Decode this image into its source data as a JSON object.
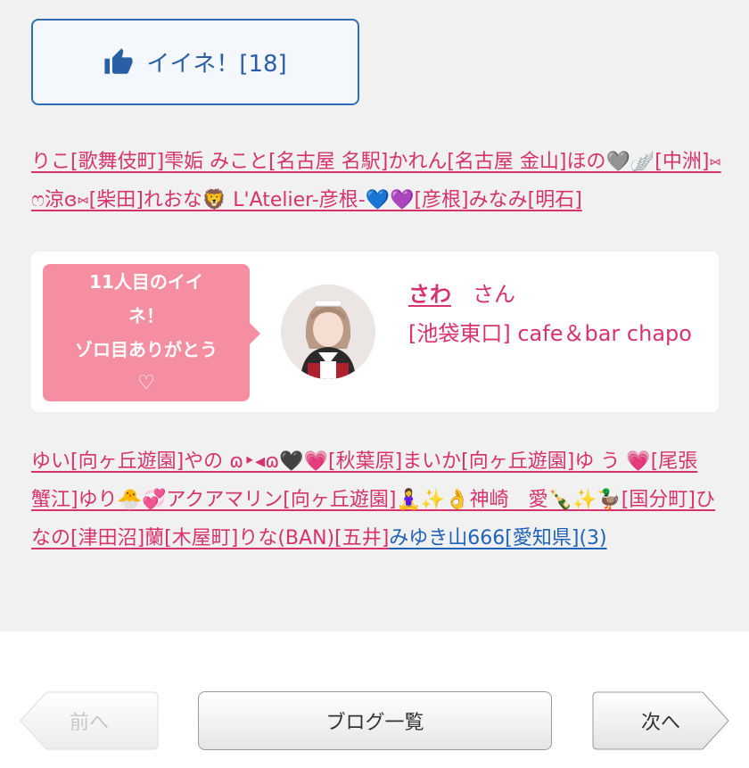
{
  "like_button": {
    "label": "イイネ！[18]",
    "icon": "thumbs-up-icon"
  },
  "list1": [
    {
      "text": "りこ[歌舞伎町]"
    },
    {
      "text": "雫姤 みこと[名古屋 名駅]"
    },
    {
      "text": "かれん[名古屋 金山]"
    },
    {
      "text": "ほの🩶🪽[中洲]"
    },
    {
      "text": "⑅ෆ涼ɞ⑅[柴田]"
    },
    {
      "text": "れおな🦁 L'Atelier-彦根-💙💜[彦根]"
    },
    {
      "text": "みなみ[明石]"
    }
  ],
  "card": {
    "bubble_lines": [
      "11人目のイイ",
      "ネ！",
      "ゾロ目ありがとう"
    ],
    "bubble_heart": "♡",
    "name": "さわ",
    "suffix": "さん",
    "shop": "[池袋東口] cafe＆bar chapo"
  },
  "list2": [
    {
      "text": "ゆい[向ヶ丘遊園]"
    },
    {
      "text": "やの ɷ‣◂ɷ🖤💗[秋葉原]"
    },
    {
      "text": "まいか[向ヶ丘遊園]"
    },
    {
      "text": "ゆ う 💗[尾張 蟹江]"
    },
    {
      "text": "ゆり🐣💞アクアマリン[向ヶ丘遊園]"
    },
    {
      "text": "🧘‍♀️✨👌神崎　愛🍾✨🦆[国分町]"
    },
    {
      "text": "ひなの[津田沼]"
    },
    {
      "text": "蘭[木屋町]"
    },
    {
      "text": "りな(BAN)[五井]"
    },
    {
      "text": "みゆき山666[愛知県](3)",
      "color": "blue"
    }
  ],
  "nav": {
    "prev": "前へ",
    "blog_list": "ブログ一覧",
    "next": "次へ"
  }
}
